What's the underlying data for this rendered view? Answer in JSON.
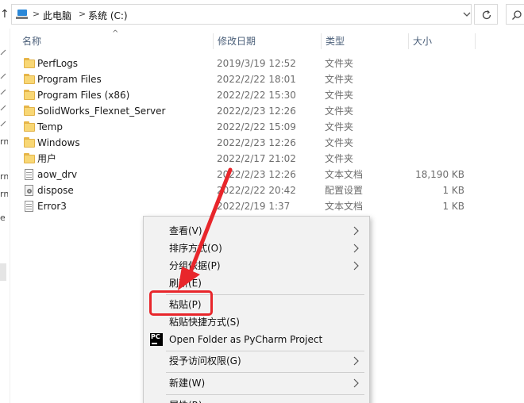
{
  "address": {
    "up_arrow_icon": "up-arrow-icon",
    "separator": ">",
    "crumbs": [
      "此电脑",
      "系统 (C:)"
    ]
  },
  "nav_fragments": [
    "rn",
    "rn",
    "rn",
    "e"
  ],
  "columns": {
    "name": "名称",
    "date": "修改日期",
    "type": "类型",
    "size": "大小"
  },
  "files": [
    {
      "name": "PerfLogs",
      "date": "2019/3/19 12:52",
      "type": "文件夹",
      "size": "",
      "icon": "folder-icon"
    },
    {
      "name": "Program Files",
      "date": "2022/2/22 18:01",
      "type": "文件夹",
      "size": "",
      "icon": "folder-icon"
    },
    {
      "name": "Program Files (x86)",
      "date": "2022/2/22 15:30",
      "type": "文件夹",
      "size": "",
      "icon": "folder-icon"
    },
    {
      "name": "SolidWorks_Flexnet_Server",
      "date": "2022/2/23 12:26",
      "type": "文件夹",
      "size": "",
      "icon": "folder-icon"
    },
    {
      "name": "Temp",
      "date": "2022/2/22 15:09",
      "type": "文件夹",
      "size": "",
      "icon": "folder-icon"
    },
    {
      "name": "Windows",
      "date": "2022/2/23 12:26",
      "type": "文件夹",
      "size": "",
      "icon": "folder-icon"
    },
    {
      "name": "用户",
      "date": "2022/2/17 21:02",
      "type": "文件夹",
      "size": "",
      "icon": "folder-icon"
    },
    {
      "name": "aow_drv",
      "date": "2022/2/23 12:26",
      "type": "文本文档",
      "size": "18,190 KB",
      "icon": "text-file-icon"
    },
    {
      "name": "dispose",
      "date": "2022/2/22 20:42",
      "type": "配置设置",
      "size": "1 KB",
      "icon": "config-file-icon"
    },
    {
      "name": "Error3",
      "date": "2022/2/19 1:37",
      "type": "文本文档",
      "size": "1 KB",
      "icon": "text-file-icon"
    }
  ],
  "context_menu": {
    "view": "查看(V)",
    "sort": "排序方式(O)",
    "group": "分组依据(P)",
    "refresh": "刷新(E)",
    "paste": "粘贴(P)",
    "paste_shortcut": "粘贴快捷方式(S)",
    "pycharm": "Open Folder as PyCharm Project",
    "pycharm_icon_text": "PC",
    "grant_access": "授予访问权限(G)",
    "new": "新建(W)",
    "properties": "属性(R)"
  },
  "colors": {
    "highlight_red": "#e8262b",
    "menu_bg": "#f2f2f2",
    "header_text": "#4c607a",
    "folder_yellow": "#f8d775"
  }
}
